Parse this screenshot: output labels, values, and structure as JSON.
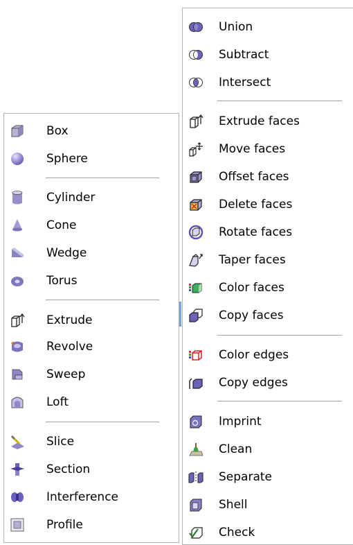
{
  "left_menu": {
    "items": [
      {
        "label": "Box",
        "icon": "box-icon"
      },
      {
        "label": "Sphere",
        "icon": "sphere-icon"
      },
      {
        "label": "Cylinder",
        "icon": "cylinder-icon"
      },
      {
        "label": "Cone",
        "icon": "cone-icon"
      },
      {
        "label": "Wedge",
        "icon": "wedge-icon"
      },
      {
        "label": "Torus",
        "icon": "torus-icon"
      },
      {
        "label": "Extrude",
        "icon": "extrude-icon"
      },
      {
        "label": "Revolve",
        "icon": "revolve-icon"
      },
      {
        "label": "Sweep",
        "icon": "sweep-icon"
      },
      {
        "label": "Loft",
        "icon": "loft-icon"
      },
      {
        "label": "Slice",
        "icon": "slice-icon"
      },
      {
        "label": "Section",
        "icon": "section-icon"
      },
      {
        "label": "Interference",
        "icon": "interference-icon"
      },
      {
        "label": "Profile",
        "icon": "profile-icon"
      }
    ]
  },
  "right_menu": {
    "items": [
      {
        "label": "Union",
        "icon": "union-icon"
      },
      {
        "label": "Subtract",
        "icon": "subtract-icon"
      },
      {
        "label": "Intersect",
        "icon": "intersect-icon"
      },
      {
        "label": "Extrude faces",
        "icon": "extrude-faces-icon"
      },
      {
        "label": "Move faces",
        "icon": "move-faces-icon"
      },
      {
        "label": "Offset faces",
        "icon": "offset-faces-icon"
      },
      {
        "label": "Delete faces",
        "icon": "delete-faces-icon"
      },
      {
        "label": "Rotate faces",
        "icon": "rotate-faces-icon"
      },
      {
        "label": "Taper faces",
        "icon": "taper-faces-icon"
      },
      {
        "label": "Color faces",
        "icon": "color-faces-icon"
      },
      {
        "label": "Copy faces",
        "icon": "copy-faces-icon"
      },
      {
        "label": "Color edges",
        "icon": "color-edges-icon"
      },
      {
        "label": "Copy edges",
        "icon": "copy-edges-icon"
      },
      {
        "label": "Imprint",
        "icon": "imprint-icon"
      },
      {
        "label": "Clean",
        "icon": "clean-icon"
      },
      {
        "label": "Separate",
        "icon": "separate-icon"
      },
      {
        "label": "Shell",
        "icon": "shell-icon"
      },
      {
        "label": "Check",
        "icon": "check-icon"
      }
    ]
  },
  "colors": {
    "menu_border": "#b4b4b4",
    "separator": "#a0a0a0",
    "icon_purple": "#8a7fd0",
    "icon_dark": "#4a4a5a"
  }
}
